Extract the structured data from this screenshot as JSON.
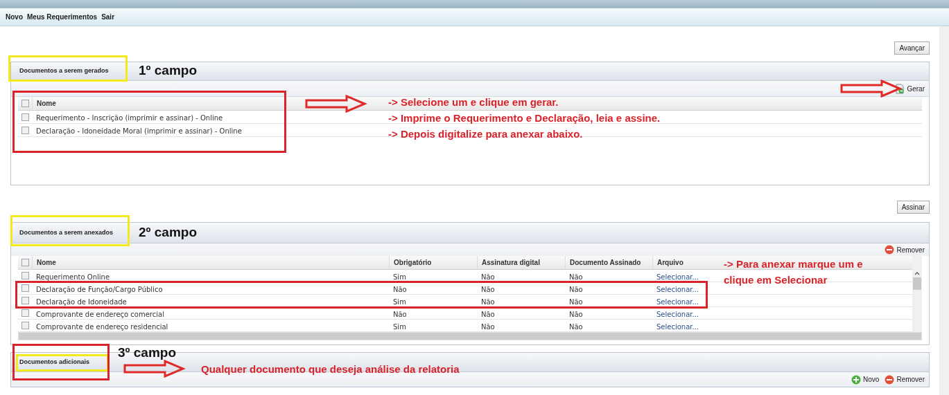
{
  "menu": [
    {
      "label": "Novo"
    },
    {
      "label": "Meus Requerimentos"
    },
    {
      "label": "Sair"
    }
  ],
  "panels": [
    {
      "title": "Documentos a serem gerados",
      "button_above": "Avançar",
      "toolbar": [
        {
          "kind": "generate",
          "label": "Gerar"
        }
      ],
      "table": {
        "all_checked": false,
        "columns": [
          {
            "label": "Nome",
            "kind": "text"
          }
        ],
        "rows": [
          {
            "checked": false,
            "cells": [
              "Requerimento - Inscrição (imprimir e assinar) - Online"
            ]
          },
          {
            "checked": false,
            "cells": [
              "Declaração - Idoneidade Moral (imprimir e assinar) - Online"
            ]
          }
        ]
      },
      "annotation": {
        "label": "1º campo",
        "notes": [
          "-> Selecione um e clique em gerar.",
          "-> Imprime o Requerimento e Declaração, leia e assine.",
          "-> Depois digitalize para anexar abaixo."
        ]
      }
    },
    {
      "title": "Documentos a serem anexados",
      "button_above": "Assinar",
      "toolbar": [
        {
          "kind": "remove",
          "label": "Remover"
        }
      ],
      "table": {
        "all_checked": false,
        "columns": [
          {
            "label": "Nome",
            "kind": "text"
          },
          {
            "label": "Obrigatório",
            "kind": "text"
          },
          {
            "label": "Assinatura digital",
            "kind": "text"
          },
          {
            "label": "Documento Assinado",
            "kind": "text"
          },
          {
            "label": "Arquivo",
            "kind": "link"
          }
        ],
        "rows": [
          {
            "checked": false,
            "cells": [
              "Requerimento Online",
              "Sim",
              "Não",
              "Não",
              "Selecionar..."
            ]
          },
          {
            "checked": false,
            "cells": [
              "Declaração de Função/Cargo Público",
              "Não",
              "Não",
              "Não",
              "Selecionar..."
            ]
          },
          {
            "checked": false,
            "cells": [
              "Declaração de Idoneidade",
              "Sim",
              "Não",
              "Não",
              "Selecionar..."
            ]
          },
          {
            "checked": false,
            "cells": [
              "Comprovante de endereço comercial",
              "Não",
              "Não",
              "Não",
              "Selecionar..."
            ]
          },
          {
            "checked": false,
            "cells": [
              "Comprovante de endereço residencial",
              "Sim",
              "Não",
              "Não",
              "Selecionar..."
            ]
          }
        ]
      },
      "annotation": {
        "label": "2º campo",
        "notes": [
          "-> Para anexar marque um e",
          "clique em Selecionar"
        ]
      }
    },
    {
      "title": "Documentos adicionais",
      "toolbar": [
        {
          "kind": "add",
          "label": "Novo"
        },
        {
          "kind": "remove",
          "label": "Remover"
        }
      ],
      "annotation": {
        "label": "3º campo",
        "notes": [
          "Qualquer documento que deseja análise da relatoria"
        ]
      }
    }
  ]
}
